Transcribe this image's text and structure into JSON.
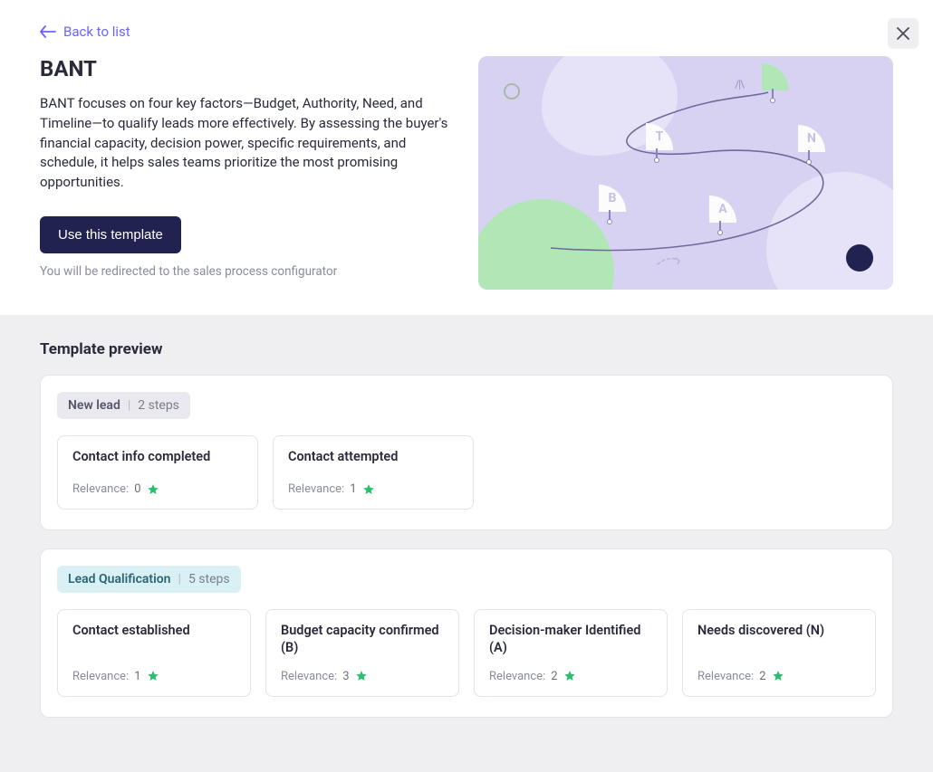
{
  "header": {
    "back_label": "Back to list",
    "title": "BANT",
    "description": "BANT focuses on four key factors—Budget, Authority, Need, and Timeline—to qualify leads more effectively. By assessing the buyer's financial capacity, decision power, specific requirements, and schedule, it helps sales teams prioritize the most promising opportunities.",
    "cta_label": "Use this template",
    "cta_hint": "You will be redirected to the sales process configurator",
    "flags": {
      "b": "B",
      "a": "A",
      "n": "N",
      "t": "T"
    }
  },
  "preview": {
    "section_title": "Template preview",
    "relevance_label": "Relevance:",
    "stages": [
      {
        "name": "New lead",
        "steps_label": "2 steps",
        "type": "new",
        "cards": [
          {
            "title": "Contact info completed",
            "relevance": "0"
          },
          {
            "title": "Contact attempted",
            "relevance": "1"
          }
        ]
      },
      {
        "name": "Lead Qualification",
        "steps_label": "5 steps",
        "type": "lq",
        "cards": [
          {
            "title": "Contact established",
            "relevance": "1"
          },
          {
            "title": "Budget capacity confirmed (B)",
            "relevance": "3"
          },
          {
            "title": "Decision-maker Identified (A)",
            "relevance": "2"
          },
          {
            "title": "Needs discovered (N)",
            "relevance": "2"
          }
        ]
      }
    ]
  }
}
